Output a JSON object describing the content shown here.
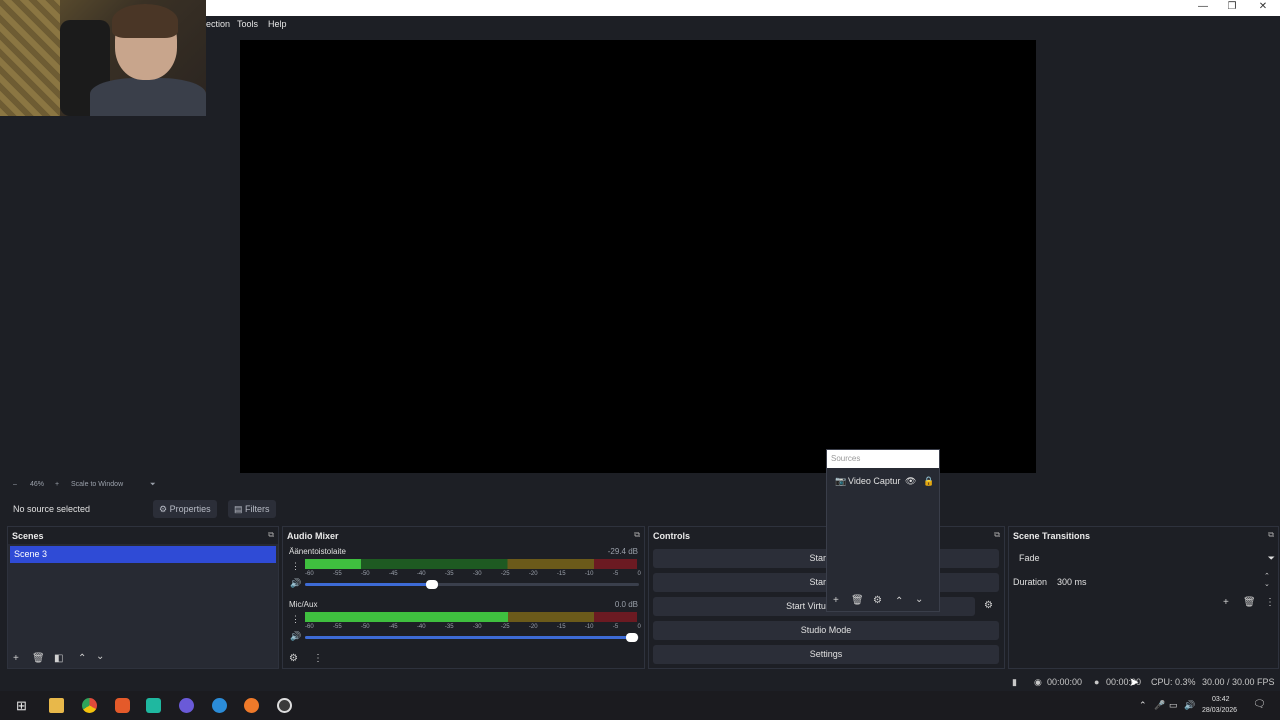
{
  "menubar": {
    "items": [
      "ection",
      "Tools",
      "Help"
    ]
  },
  "window": {
    "minimize": "—",
    "restore": "❐",
    "close": "✕"
  },
  "zoom": {
    "minus": "–",
    "level": "46%",
    "plus": "+",
    "mode": "Scale to Window",
    "caret": "⏷"
  },
  "source_bar": {
    "status": "No source selected",
    "properties": "Properties",
    "filters": "Filters",
    "properties_icon": "gear-icon",
    "filters_icon": "filter-icon"
  },
  "scenes": {
    "title": "Scenes",
    "items": [
      "Scene 3"
    ],
    "float": "⧉"
  },
  "mixer": {
    "title": "Audio Mixer",
    "ticks": [
      "-60",
      "-55",
      "-50",
      "-45",
      "-40",
      "-35",
      "-30",
      "-25",
      "-20",
      "-15",
      "-10",
      "-5",
      "0"
    ],
    "channels": [
      {
        "name": "Äänentoistolaite",
        "db": "-29.4 dB",
        "level": 0.17,
        "volume": 0.38
      },
      {
        "name": "Mic/Aux",
        "db": "0.0 dB",
        "level": 0.61,
        "volume": 0.98
      }
    ]
  },
  "controls": {
    "title": "Controls",
    "buttons": [
      "Start Str",
      "Start Re",
      "Start Virtual C",
      "Studio Mode",
      "Settings"
    ]
  },
  "sources": {
    "title": "Sources",
    "item": "Video Captur"
  },
  "transitions": {
    "title": "Scene Transitions",
    "type": "Fade",
    "duration_label": "Duration",
    "duration_value": "300 ms"
  },
  "status": {
    "time1": "00:00:00",
    "time2": "00:00:00",
    "cpu": "CPU: 0.3%",
    "fps": "30.00 / 30.00 FPS"
  },
  "taskbar": {
    "time": "03:42",
    "date": "28/03/2026"
  },
  "colors": {
    "accent": "#2f4bd6",
    "panel": "#272a33",
    "background": "#1d1f25"
  }
}
